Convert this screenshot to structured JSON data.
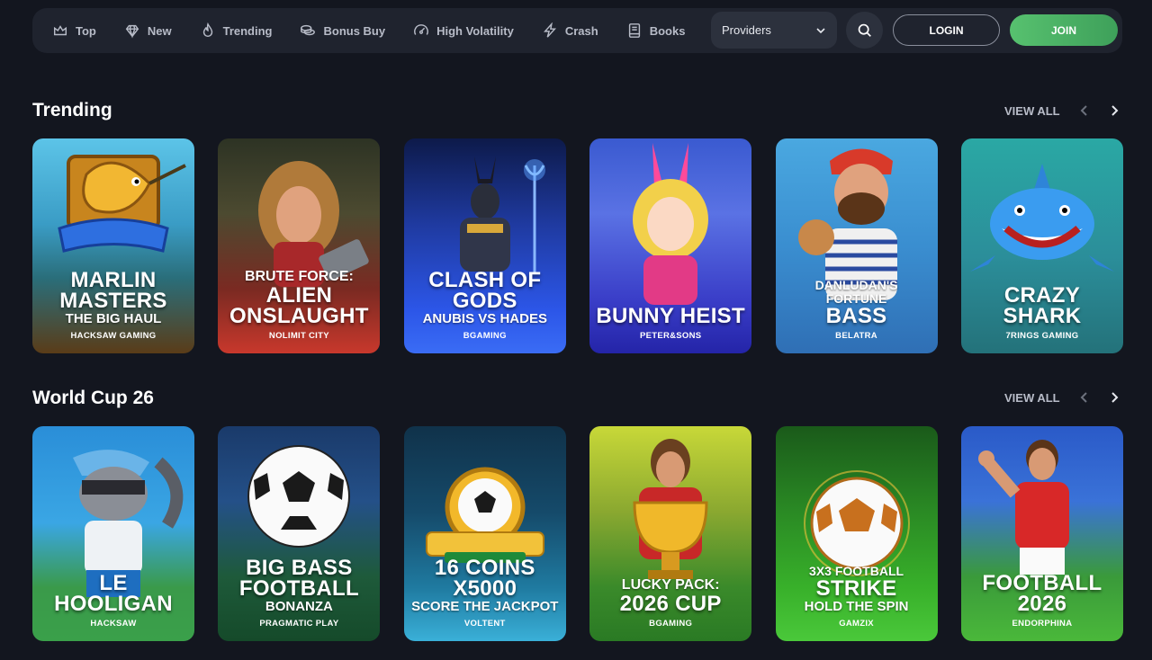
{
  "nav": {
    "items": [
      {
        "label": "Top",
        "icon": "crown-icon"
      },
      {
        "label": "New",
        "icon": "diamond-icon"
      },
      {
        "label": "Trending",
        "icon": "flame-icon"
      },
      {
        "label": "Bonus Buy",
        "icon": "coins-icon"
      },
      {
        "label": "High Volatility",
        "icon": "gauge-icon"
      },
      {
        "label": "Crash",
        "icon": "bolt-icon"
      },
      {
        "label": "Books",
        "icon": "book-icon"
      }
    ],
    "providers_label": "Providers",
    "login_label": "LOGIN",
    "join_label": "JOIN"
  },
  "sections": [
    {
      "title": "Trending",
      "view_all": "VIEW ALL",
      "games": [
        {
          "line0": "",
          "line1": "MARLIN MASTERS",
          "line2": "THE BIG HAUL",
          "provider": "HACKSAW GAMING"
        },
        {
          "line0": "BRUTE FORCE:",
          "line1": "ALIEN ONSLAUGHT",
          "line2": "",
          "provider": "NOLIMIT CITY"
        },
        {
          "line0": "",
          "line1": "CLASH OF GODS",
          "line2": "ANUBIS VS HADES",
          "provider": "BGAMING"
        },
        {
          "line0": "",
          "line1": "BUNNY HEIST",
          "line2": "",
          "provider": "PETER&SONS"
        },
        {
          "line0": "DANLUDAN'S FORTUNE",
          "line1": "BASS",
          "line2": "",
          "provider": "BELATRA"
        },
        {
          "line0": "",
          "line1": "CRAZY SHARK",
          "line2": "",
          "provider": "7RINGS GAMING"
        }
      ]
    },
    {
      "title": "World Cup 26",
      "view_all": "VIEW ALL",
      "games": [
        {
          "line0": "",
          "line1": "LE HOOLIGAN",
          "line2": "",
          "provider": "HACKSAW"
        },
        {
          "line0": "",
          "line1": "BIG BASS FOOTBALL",
          "line2": "BONANZA",
          "provider": "PRAGMATIC PLAY"
        },
        {
          "line0": "",
          "line1": "16 COINS X5000",
          "line2": "SCORE THE JACKPOT",
          "provider": "VOLTENT"
        },
        {
          "line0": "LUCKY PACK:",
          "line1": "2026 CUP",
          "line2": "",
          "provider": "BGAMING"
        },
        {
          "line0": "3X3 FOOTBALL",
          "line1": "STRIKE",
          "line2": "HOLD THE SPIN",
          "provider": "GAMZIX"
        },
        {
          "line0": "",
          "line1": "FOOTBALL 2026",
          "line2": "",
          "provider": "ENDORPHINA"
        }
      ]
    }
  ],
  "colors": {
    "background": "#13161f",
    "nav_bg": "#1f232e",
    "join_green": "#4cae64"
  }
}
